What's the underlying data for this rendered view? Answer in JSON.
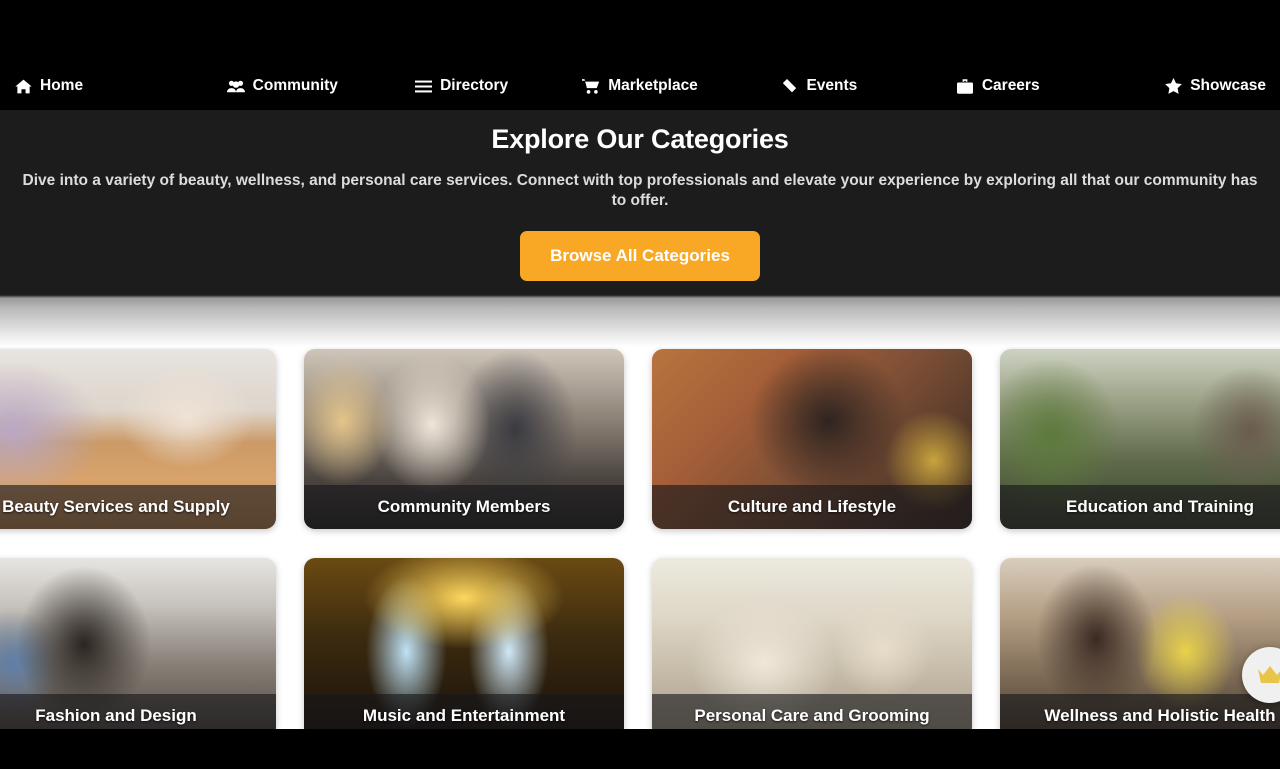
{
  "nav": {
    "items": [
      {
        "label": "Home",
        "icon": "home-icon"
      },
      {
        "label": "Community",
        "icon": "users-group-icon"
      },
      {
        "label": "Directory",
        "icon": "list-lines-icon"
      },
      {
        "label": "Marketplace",
        "icon": "shopping-cart-icon"
      },
      {
        "label": "Events",
        "icon": "ticket-icon"
      },
      {
        "label": "Careers",
        "icon": "briefcase-icon"
      },
      {
        "label": "Showcase",
        "icon": "star-icon"
      }
    ]
  },
  "hero": {
    "title": "Explore Our Categories",
    "description": "Dive into a variety of beauty, wellness, and personal care services. Connect with top professionals and elevate your experience by exploring all that our community has to offer.",
    "cta_label": "Browse All Categories",
    "cta_color": "#f9a825",
    "background_color": "#1c1c1c"
  },
  "categories": [
    {
      "label": "Beauty Services and Supply",
      "image": "beauty-salon-interior-photo"
    },
    {
      "label": "Community Members",
      "image": "people-gathering-photo"
    },
    {
      "label": "Culture and Lifestyle",
      "image": "woman-with-headwrap-photo"
    },
    {
      "label": "Education and Training",
      "image": "man-in-greenhouse-photo"
    },
    {
      "label": "Fashion and Design",
      "image": "woman-in-city-street-photo"
    },
    {
      "label": "Music and Entertainment",
      "image": "concert-stage-lights-photo"
    },
    {
      "label": "Personal Care and Grooming",
      "image": "spa-products-table-photo"
    },
    {
      "label": "Wellness and Holistic Health",
      "image": "mother-and-child-photo"
    }
  ],
  "floating_badge": {
    "icon": "crown-icon",
    "color": "#e8c54a"
  }
}
